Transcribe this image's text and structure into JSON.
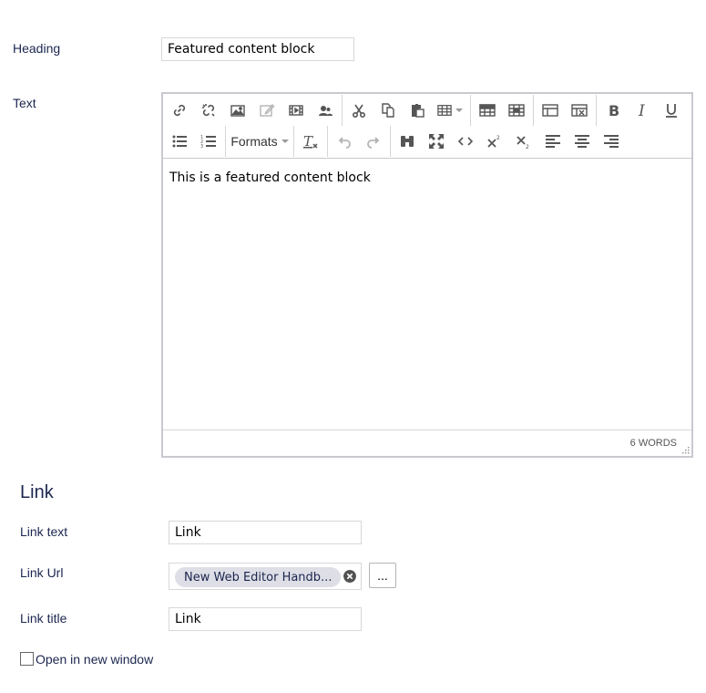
{
  "fields": {
    "heading": {
      "label": "Heading",
      "value": "Featured content block"
    },
    "text": {
      "label": "Text"
    }
  },
  "editor": {
    "content": "This is a featured content block",
    "word_count": "6 WORDS",
    "formats_label": "Formats"
  },
  "link_section": {
    "title": "Link",
    "link_text": {
      "label": "Link text",
      "value": "Link"
    },
    "link_url": {
      "label": "Link Url",
      "value": "New Web Editor Handb...",
      "picker_label": "..."
    },
    "link_title": {
      "label": "Link title",
      "value": "Link"
    },
    "open_new_window": {
      "label": "Open in new window",
      "checked": false
    }
  }
}
